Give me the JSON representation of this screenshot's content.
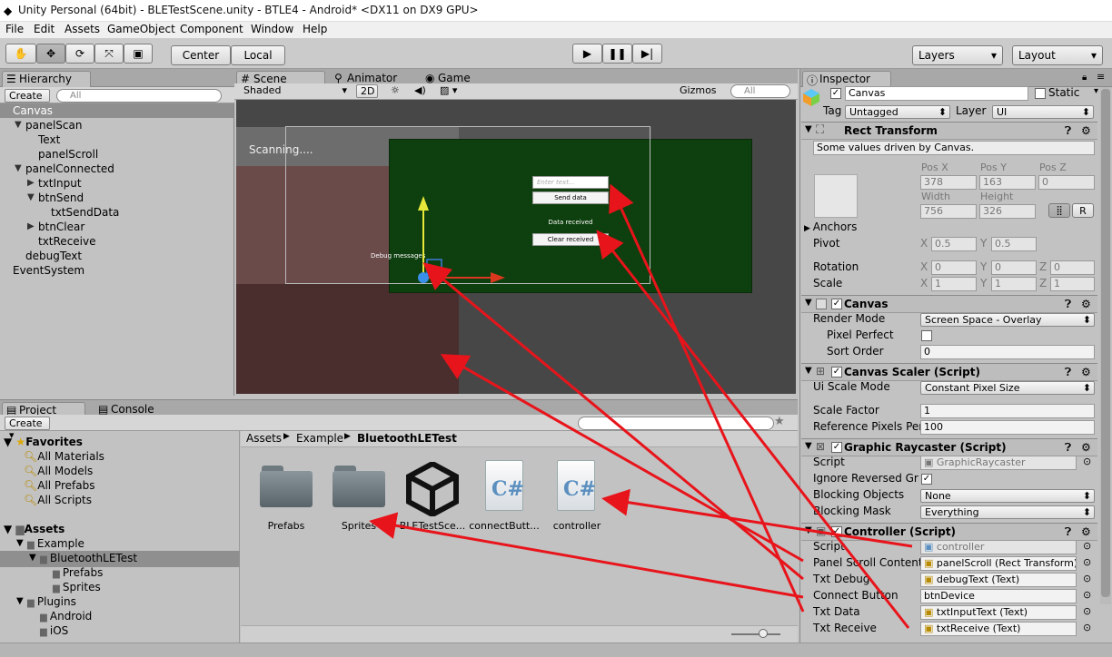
{
  "window": {
    "title": "Unity Personal (64bit) - BLETestScene.unity - BTLE4 - Android* <DX11 on DX9 GPU>"
  },
  "menu": [
    "File",
    "Edit",
    "Assets",
    "GameObject",
    "Component",
    "Window",
    "Help"
  ],
  "toolbar": {
    "pivot": "Center",
    "space": "Local",
    "layers": "Layers",
    "layout": "Layout"
  },
  "hierarchy": {
    "tab": "Hierarchy",
    "create": "Create",
    "search_placeholder": "All",
    "items": [
      {
        "label": "Canvas",
        "depth": 0,
        "arrow": "",
        "selected": true
      },
      {
        "label": "panelScan",
        "depth": 1,
        "arrow": "▼"
      },
      {
        "label": "Text",
        "depth": 2,
        "arrow": ""
      },
      {
        "label": "panelScroll",
        "depth": 2,
        "arrow": ""
      },
      {
        "label": "panelConnected",
        "depth": 1,
        "arrow": "▼"
      },
      {
        "label": "txtInput",
        "depth": 2,
        "arrow": "▶"
      },
      {
        "label": "btnSend",
        "depth": 2,
        "arrow": "▼"
      },
      {
        "label": "txtSendData",
        "depth": 3,
        "arrow": ""
      },
      {
        "label": "btnClear",
        "depth": 2,
        "arrow": "▶"
      },
      {
        "label": "txtReceive",
        "depth": 2,
        "arrow": ""
      },
      {
        "label": "debugText",
        "depth": 1,
        "arrow": ""
      },
      {
        "label": "EventSystem",
        "depth": 0,
        "arrow": ""
      }
    ]
  },
  "scene": {
    "tabs": [
      "Scene",
      "Animator",
      "Game"
    ],
    "shading": "Shaded",
    "mode2d": "2D",
    "gizmos": "Gizmos",
    "search_placeholder": "All",
    "scanning": "Scanning....",
    "input_placeholder": "Enter text...",
    "send": "Send data",
    "data_received": "Data received",
    "clear": "Clear received",
    "debug": "Debug messages"
  },
  "project": {
    "tabs": [
      "Project",
      "Console"
    ],
    "create": "Create",
    "favorites_title": "Favorites",
    "favorites": [
      "All Materials",
      "All Models",
      "All Prefabs",
      "All Scripts"
    ],
    "assets_title": "Assets",
    "assets_tree": [
      {
        "label": "Example",
        "depth": 1,
        "arrow": "▼"
      },
      {
        "label": "BluetoothLETest",
        "depth": 2,
        "arrow": "▼",
        "selected": true
      },
      {
        "label": "Prefabs",
        "depth": 3,
        "arrow": ""
      },
      {
        "label": "Sprites",
        "depth": 3,
        "arrow": ""
      },
      {
        "label": "Plugins",
        "depth": 1,
        "arrow": "▼"
      },
      {
        "label": "Android",
        "depth": 2,
        "arrow": ""
      },
      {
        "label": "iOS",
        "depth": 2,
        "arrow": ""
      }
    ],
    "breadcrumb": [
      "Assets",
      "Example",
      "BluetoothLETest"
    ],
    "files": [
      "Prefabs",
      "Sprites",
      "BLETestSce...",
      "connectButt...",
      "controller"
    ]
  },
  "inspector": {
    "tab": "Inspector",
    "name": "Canvas",
    "static": "Static",
    "tag_label": "Tag",
    "tag": "Untagged",
    "layer_label": "Layer",
    "layer": "UI",
    "rect": {
      "title": "Rect Transform",
      "note": "Some values driven by Canvas.",
      "posx_l": "Pos X",
      "posy_l": "Pos Y",
      "posz_l": "Pos Z",
      "posx": "378",
      "posy": "163",
      "posz": "0",
      "w_l": "Width",
      "h_l": "Height",
      "w": "756",
      "h": "326",
      "anchors": "Anchors",
      "pivot": "Pivot",
      "pivot_x": "0.5",
      "pivot_y": "0.5",
      "rotation": "Rotation",
      "rx": "0",
      "ry": "0",
      "rz": "0",
      "scale": "Scale",
      "sx": "1",
      "sy": "1",
      "sz": "1",
      "r_btn": "R"
    },
    "canvas": {
      "title": "Canvas",
      "render_mode_l": "Render Mode",
      "render_mode": "Screen Space - Overlay",
      "pixel_perfect": "Pixel Perfect",
      "sort_order_l": "Sort Order",
      "sort_order": "0"
    },
    "scaler": {
      "title": "Canvas Scaler (Script)",
      "ui_scale_l": "Ui Scale Mode",
      "ui_scale": "Constant Pixel Size",
      "scale_factor_l": "Scale Factor",
      "scale_factor": "1",
      "ref_ppu_l": "Reference Pixels Per",
      "ref_ppu": "100"
    },
    "raycaster": {
      "title": "Graphic Raycaster (Script)",
      "script_l": "Script",
      "script": "GraphicRaycaster",
      "ignore_l": "Ignore Reversed Gra",
      "blocking_obj_l": "Blocking Objects",
      "blocking_obj": "None",
      "blocking_mask_l": "Blocking Mask",
      "blocking_mask": "Everything"
    },
    "controller": {
      "title": "Controller (Script)",
      "rows": [
        {
          "label": "Script",
          "value": "controller"
        },
        {
          "label": "Panel Scroll Content",
          "value": "panelScroll (Rect Transform)"
        },
        {
          "label": "Txt Debug",
          "value": "debugText (Text)"
        },
        {
          "label": "Connect Button",
          "value": "btnDevice"
        },
        {
          "label": "Txt Data",
          "value": "txtInputText (Text)"
        },
        {
          "label": "Txt Receive",
          "value": "txtReceive (Text)"
        }
      ]
    }
  },
  "colors": {
    "annotation": "#e8141b",
    "scene_green": "#0e3f0e",
    "scene_bg": "#474747"
  }
}
